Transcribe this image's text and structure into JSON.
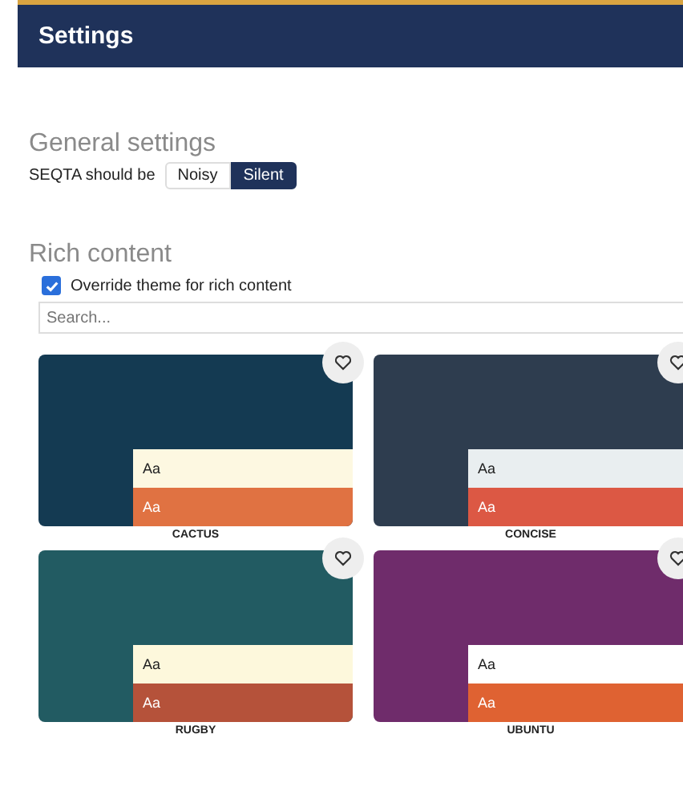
{
  "header": {
    "title": "Settings"
  },
  "general": {
    "heading": "General settings",
    "label": "SEQTA should be",
    "options": [
      {
        "label": "Noisy",
        "selected": false
      },
      {
        "label": "Silent",
        "selected": true
      }
    ]
  },
  "rich": {
    "heading": "Rich content",
    "override": {
      "label": "Override theme for rich content",
      "checked": true
    },
    "search": {
      "placeholder": "Search..."
    },
    "themes": [
      {
        "name": "CACTUS",
        "color": "#143a52",
        "favorite": false,
        "swatches": [
          {
            "sample": "Aa",
            "color": "#fdf8e1"
          },
          {
            "sample": "Aa",
            "color": "#e07242"
          }
        ]
      },
      {
        "name": "CONCISE",
        "color": "#2e3d4f",
        "favorite": false,
        "swatches": [
          {
            "sample": "Aa",
            "color": "#e9eef0"
          },
          {
            "sample": "Aa",
            "color": "#dc5844"
          }
        ]
      },
      {
        "name": "RUGBY",
        "color": "#225b62",
        "favorite": false,
        "swatches": [
          {
            "sample": "Aa",
            "color": "#fdf8dc"
          },
          {
            "sample": "Aa",
            "color": "#b5523a"
          }
        ]
      },
      {
        "name": "UBUNTU",
        "color": "#6f2c6b",
        "favorite": false,
        "swatches": [
          {
            "sample": "Aa",
            "color": "#ffffff"
          },
          {
            "sample": "Aa",
            "color": "#df6232"
          }
        ]
      }
    ]
  }
}
